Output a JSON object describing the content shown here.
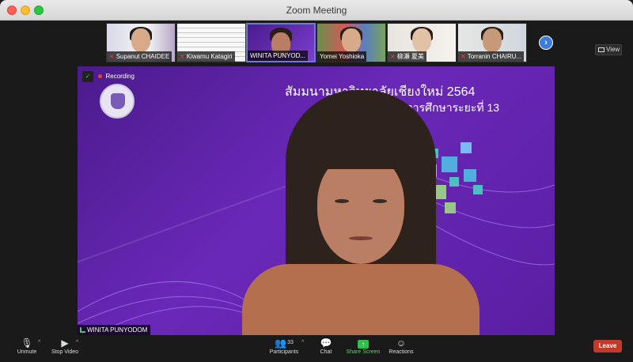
{
  "window": {
    "title": "Zoom Meeting"
  },
  "participants_strip": {
    "tiles": [
      {
        "name": "Supanut CHAIDEE",
        "muted": true
      },
      {
        "name": "Kiwamu Katagiri",
        "muted": true
      },
      {
        "name": "WINITA PUNYOD...",
        "muted": false
      },
      {
        "name": "Yomei Yoshioka",
        "muted": false
      },
      {
        "name": "柳瀬 夏美",
        "muted": true
      },
      {
        "name": "Torranin CHAIRU...",
        "muted": true
      }
    ],
    "view_label": "View"
  },
  "main_video": {
    "recording_label": "Recording",
    "slide_line1": "สัมมนามหาวิทยาลัยเชียงใหม่ 2564",
    "slide_line2": "พัฒนาการศึกษาระยะที่ 13",
    "speaker_name": "WINITA PUNYODOM"
  },
  "toolbar": {
    "unmute": "Unmute",
    "stop_video": "Stop Video",
    "participants": "Participants",
    "participants_count": "33",
    "chat": "Chat",
    "share_screen": "Share Screen",
    "reactions": "Reactions",
    "leave": "Leave"
  },
  "colors": {
    "accent": "#3c7ddc",
    "share_green": "#2fbf4a",
    "leave_red": "#c13a2b",
    "slide_purple": "#6a28b8"
  }
}
